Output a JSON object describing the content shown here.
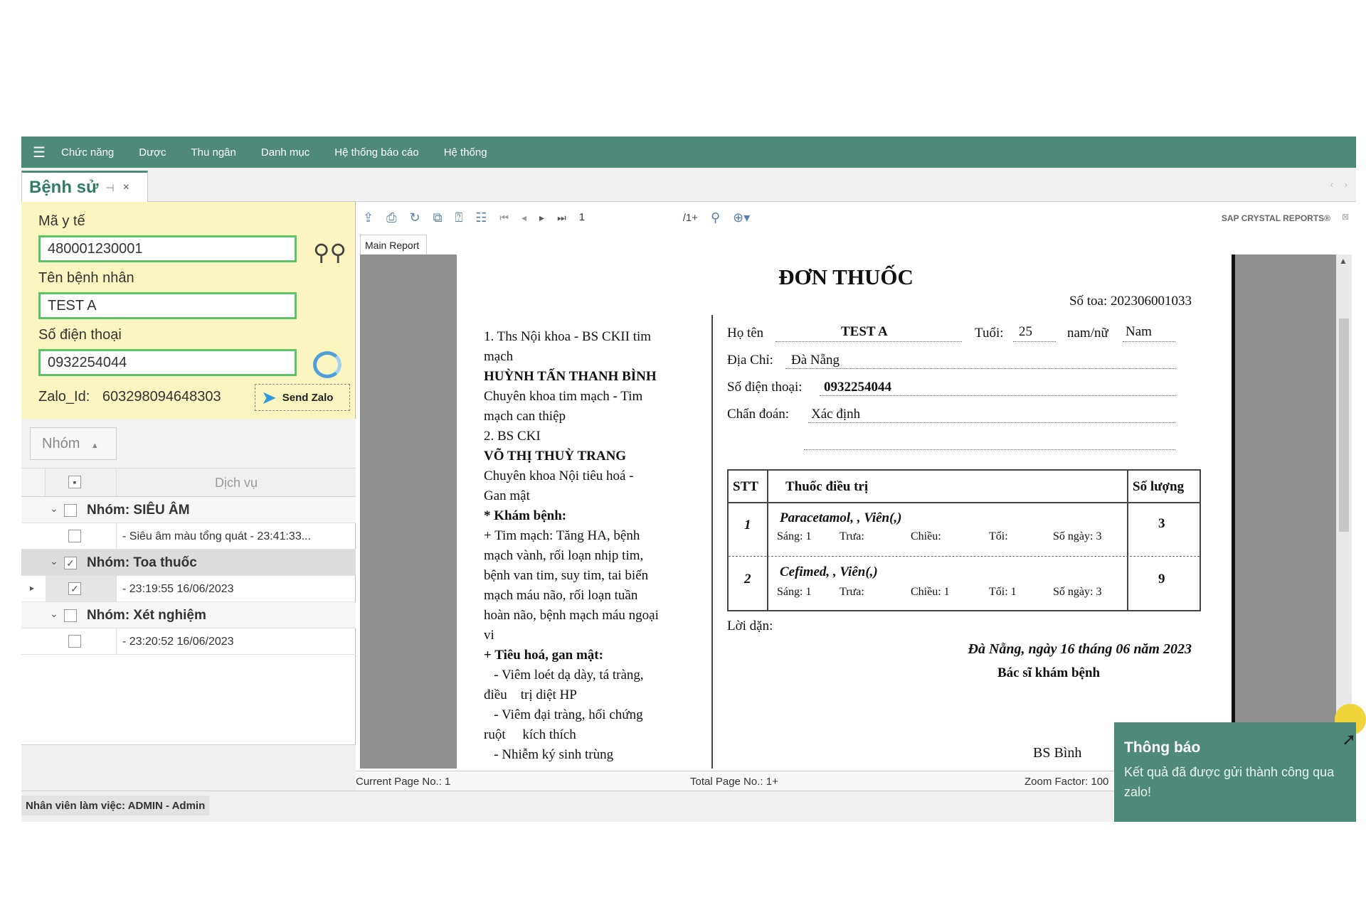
{
  "menu": [
    "Chức năng",
    "Dược",
    "Thu ngân",
    "Danh mục",
    "Hệ thống báo cáo",
    "Hệ thống"
  ],
  "tab": {
    "title": "Bệnh sử",
    "pin": "⊣",
    "close": "×"
  },
  "search": {
    "ma_yte_label": "Mã y tế",
    "ma_yte_value": "480001230001",
    "ten_label": "Tên bệnh nhân",
    "ten_value": "TEST A",
    "sdt_label": "Số điện thoại",
    "sdt_value": "0932254044",
    "zalo_label": "Zalo_Id:",
    "zalo_value": "603298094648303",
    "send_label": "Send Zalo"
  },
  "group": {
    "label": "Nhóm"
  },
  "grid": {
    "header": "Dịch vụ",
    "g1": {
      "title": "Nhóm: SIÊU ÂM",
      "row": "- Siêu âm màu tổng quát - 23:41:33..."
    },
    "g2": {
      "title": "Nhóm: Toa thuốc",
      "row": "- 23:19:55 16/06/2023"
    },
    "g3": {
      "title": "Nhóm: Xét nghiệm",
      "row": "- 23:20:52 16/06/2023"
    }
  },
  "status_user": "Nhân viên làm việc: ADMIN - Admin",
  "report": {
    "toolbar": {
      "page": "1",
      "total": "/1+",
      "brand": "SAP CRYSTAL REPORTS®"
    },
    "tab": "Main Report",
    "status": {
      "cur": "Current Page No.: 1",
      "total": "Total Page No.: 1+",
      "zoom": "Zoom Factor: 100"
    }
  },
  "doc": {
    "title": "ĐƠN THUỐC",
    "so_toa": "Số toa: 202306001033",
    "left_lines": [
      "1. Ths Nội khoa - BS CKII tim",
      "mạch",
      "HUỲNH TẤN THANH BÌNH",
      "Chuyên khoa tim mạch - Tim",
      "mạch can thiệp",
      "2. BS CKI",
      "VÕ THỊ THUỲ TRANG",
      "Chuyên khoa Nội tiêu hoá -",
      "Gan mật",
      "* Khám bệnh:",
      "+ Tim mạch: Tăng HA, bệnh",
      "mạch vành, rối loạn nhịp tim,",
      "bệnh van tim, suy tim, tai biến",
      "mạch máu não, rối loạn tuần",
      "hoàn não, bệnh mạch máu ngoại",
      "vi",
      "+ Tiêu hoá, gan mật:",
      "   - Viêm loét dạ dày, tá tràng,",
      "điều    trị diệt HP",
      "   - Viêm đại tràng, hối chứng",
      "ruột     kích thích",
      "   - Nhiễm ký sinh trùng"
    ],
    "hoten_label": "Họ tên",
    "hoten": "TEST A",
    "tuoi_label": "Tuổi:",
    "tuoi": "25",
    "gt_label": "nam/nữ",
    "gt": "Nam",
    "diachi_label": "Địa Chỉ:",
    "diachi": "Đà Nẵng",
    "sdt_label": "Số điện thoại:",
    "sdt": "0932254044",
    "chandoan_label": "Chẩn đoán:",
    "chandoan": "Xác định",
    "rx_head": {
      "stt": "STT",
      "thuoc": "Thuốc điều trị",
      "sl": "Số lượng"
    },
    "rx": [
      {
        "stt": "1",
        "name": "Paracetamol, , Viên(,)",
        "sang": "Sáng: 1",
        "trua": "Trưa:",
        "chieu": "Chiều:",
        "toi": "Tối:",
        "songay": "Số ngày: 3",
        "sl": "3"
      },
      {
        "stt": "2",
        "name": "Cefimed, , Viên(,)",
        "sang": "Sáng: 1",
        "trua": "Trưa:",
        "chieu": "Chiều: 1",
        "toi": "Tối: 1",
        "songay": "Số ngày: 3",
        "sl": "9"
      }
    ],
    "loidan": "Lời dặn:",
    "date": "Đà Nẵng, ngày 16 tháng 06 năm 2023",
    "doctor_title": "Bác sĩ khám bệnh",
    "doctor": "BS Bình"
  },
  "toast": {
    "title": "Thông báo",
    "msg": "Kết quả đã được gửi thành công qua zalo!"
  }
}
